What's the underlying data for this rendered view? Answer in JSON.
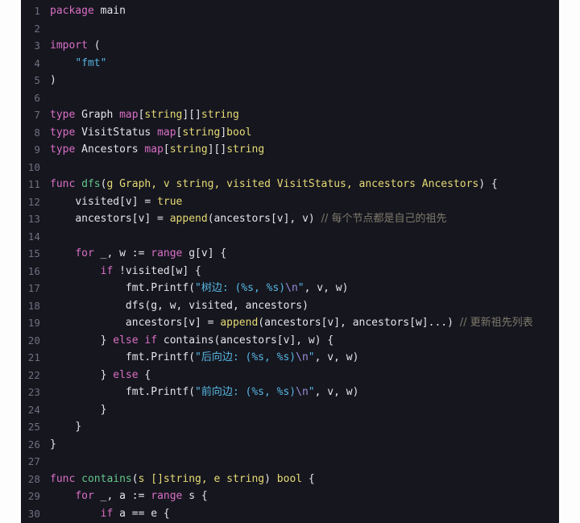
{
  "editor": {
    "language": "Go",
    "theme_name": "dark",
    "background_color": "#16161f",
    "page_background_color": "#fdfdfd",
    "gutter_text_color": "#6f6f80",
    "default_text_color": "#e6e6ef",
    "first_line_number": 1,
    "last_line_number": 30,
    "total_visible_lines": 30,
    "colors": {
      "keyword": "#d96fc4",
      "function": "#63c68a",
      "type": "#e6db74",
      "string": "#56b6e0",
      "escape": "#9a8fd8",
      "comment": "#7e7a6a",
      "plain": "#e4e4ee",
      "builtin": "#e6db74"
    },
    "lines": [
      {
        "n": 1,
        "text": "package main"
      },
      {
        "n": 2,
        "text": ""
      },
      {
        "n": 3,
        "text": "import ("
      },
      {
        "n": 4,
        "text": "    \"fmt\""
      },
      {
        "n": 5,
        "text": ")"
      },
      {
        "n": 6,
        "text": ""
      },
      {
        "n": 7,
        "text": "type Graph map[string][]string"
      },
      {
        "n": 8,
        "text": "type VisitStatus map[string]bool"
      },
      {
        "n": 9,
        "text": "type Ancestors map[string][]string"
      },
      {
        "n": 10,
        "text": ""
      },
      {
        "n": 11,
        "text": "func dfs(g Graph, v string, visited VisitStatus, ancestors Ancestors) {"
      },
      {
        "n": 12,
        "text": "    visited[v] = true"
      },
      {
        "n": 13,
        "text": "    ancestors[v] = append(ancestors[v], v) // 每个节点都是自己的祖先"
      },
      {
        "n": 14,
        "text": ""
      },
      {
        "n": 15,
        "text": "    for _, w := range g[v] {"
      },
      {
        "n": 16,
        "text": "        if !visited[w] {"
      },
      {
        "n": 17,
        "text": "            fmt.Printf(\"树边: (%s, %s)\\n\", v, w)"
      },
      {
        "n": 18,
        "text": "            dfs(g, w, visited, ancestors)"
      },
      {
        "n": 19,
        "text": "            ancestors[v] = append(ancestors[v], ancestors[w]...) // 更新祖先列表"
      },
      {
        "n": 20,
        "text": "        } else if contains(ancestors[v], w) {"
      },
      {
        "n": 21,
        "text": "            fmt.Printf(\"后向边: (%s, %s)\\n\", v, w)"
      },
      {
        "n": 22,
        "text": "        } else {"
      },
      {
        "n": 23,
        "text": "            fmt.Printf(\"前向边: (%s, %s)\\n\", v, w)"
      },
      {
        "n": 24,
        "text": "        }"
      },
      {
        "n": 25,
        "text": "    }"
      },
      {
        "n": 26,
        "text": "}"
      },
      {
        "n": 27,
        "text": ""
      },
      {
        "n": 28,
        "text": "func contains(s []string, e string) bool {"
      },
      {
        "n": 29,
        "text": "    for _, a := range s {"
      },
      {
        "n": 30,
        "text": "        if a == e {"
      }
    ],
    "line_numbers": [
      "1",
      "2",
      "3",
      "4",
      "5",
      "6",
      "7",
      "8",
      "9",
      "10",
      "11",
      "12",
      "13",
      "14",
      "15",
      "16",
      "17",
      "18",
      "19",
      "20",
      "21",
      "22",
      "23",
      "24",
      "25",
      "26",
      "27",
      "28",
      "29",
      "30"
    ],
    "comments": [
      {
        "line": 13,
        "text": "// 每个节点都是自己的祖先"
      },
      {
        "line": 19,
        "text": "// 更新祖先列表"
      }
    ],
    "strings": [
      {
        "line": 4,
        "text": "\"fmt\""
      },
      {
        "line": 17,
        "text": "\"树边: (%s, %s)\\n\""
      },
      {
        "line": 21,
        "text": "\"后向边: (%s, %s)\\n\""
      },
      {
        "line": 23,
        "text": "\"前向边: (%s, %s)\\n\""
      }
    ]
  }
}
